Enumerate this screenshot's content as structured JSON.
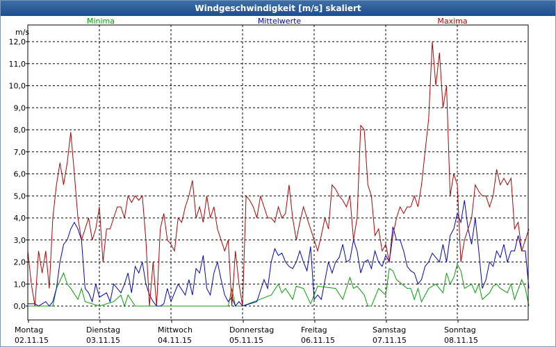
{
  "window": {
    "title": "Windgeschwindigkeit [m/s] skaliert"
  },
  "chart_data": {
    "type": "line",
    "title": "Windgeschwindigkeit [m/s] skaliert",
    "ylabel": "m/s",
    "ylim": [
      0,
      12
    ],
    "xlim": [
      0,
      7
    ],
    "grid": true,
    "yticks": [
      "0,0",
      "1,0",
      "2,0",
      "3,0",
      "4,0",
      "5,0",
      "6,0",
      "7,0",
      "8,0",
      "9,0",
      "10,0",
      "11,0",
      "12,0"
    ],
    "xticks": [
      {
        "day": "Montag",
        "date": "02.11.15"
      },
      {
        "day": "Dienstag",
        "date": "03.11.15"
      },
      {
        "day": "Mittwoch",
        "date": "04.11.15"
      },
      {
        "day": "Donnerstag",
        "date": "05.11.15"
      },
      {
        "day": "Freitag",
        "date": "06.11.15"
      },
      {
        "day": "Samstag",
        "date": "07.11.15"
      },
      {
        "day": "Sonntag",
        "date": "08.11.15"
      }
    ],
    "series": [
      {
        "name": "Minima",
        "color": "#00a000",
        "x": [
          0,
          0.35,
          0.4,
          0.5,
          0.55,
          0.6,
          0.7,
          0.75,
          0.8,
          1.0,
          1.2,
          1.3,
          1.35,
          1.4,
          1.5,
          1.55,
          1.6,
          1.7,
          1.75,
          1.8,
          2.0,
          2.8,
          2.85,
          2.9,
          3.0,
          3.4,
          3.5,
          3.55,
          3.6,
          3.7,
          3.75,
          3.85,
          3.95,
          4.0,
          4.05,
          4.3,
          4.4,
          4.5,
          4.55,
          4.6,
          4.7,
          4.75,
          4.8,
          4.9,
          5.0,
          5.05,
          5.1,
          5.15,
          5.3,
          5.35,
          5.4,
          5.45,
          5.5,
          5.6,
          5.7,
          5.8,
          5.85,
          5.9,
          5.95,
          6.0,
          6.05,
          6.1,
          6.2,
          6.25,
          6.3,
          6.35,
          6.45,
          6.5,
          6.55,
          6.6,
          6.7,
          6.75,
          6.8,
          6.9,
          6.95,
          7.0
        ],
        "y": [
          0,
          0,
          0.8,
          1.5,
          1.0,
          0.8,
          0.3,
          0.8,
          0.2,
          0,
          0.2,
          0.5,
          0,
          0.5,
          0,
          0,
          0,
          0,
          0,
          0,
          0,
          0,
          0.8,
          0,
          0,
          0.5,
          1.0,
          0.6,
          0.8,
          0.3,
          0.9,
          0.8,
          0.1,
          0.5,
          0.9,
          0.8,
          0.3,
          1.3,
          0.8,
          0.9,
          0.5,
          0,
          0,
          0.8,
          0.5,
          1.7,
          1.6,
          1.2,
          0.8,
          0.8,
          0.3,
          0.8,
          0.2,
          0.8,
          1.0,
          0.6,
          1.5,
          1.0,
          1.3,
          1.9,
          1.6,
          0.8,
          1.0,
          0.6,
          1.0,
          0.3,
          0.6,
          0.9,
          1.0,
          0.8,
          0.6,
          1.0,
          0.3,
          1.2,
          0.8,
          0
        ]
      },
      {
        "name": "Mittelwerte",
        "color": "#0000c0",
        "x": [
          0,
          0.1,
          0.15,
          0.2,
          0.25,
          0.3,
          0.35,
          0.4,
          0.45,
          0.5,
          0.55,
          0.6,
          0.65,
          0.7,
          0.75,
          0.8,
          0.85,
          0.9,
          0.95,
          1.0,
          1.1,
          1.15,
          1.2,
          1.3,
          1.35,
          1.4,
          1.45,
          1.5,
          1.55,
          1.6,
          1.65,
          1.7,
          1.75,
          1.8,
          1.85,
          1.9,
          1.95,
          2.0,
          2.1,
          2.2,
          2.25,
          2.3,
          2.35,
          2.4,
          2.45,
          2.5,
          2.55,
          2.6,
          2.65,
          2.7,
          2.75,
          2.8,
          2.85,
          2.9,
          2.95,
          3.0,
          3.2,
          3.3,
          3.35,
          3.4,
          3.45,
          3.5,
          3.55,
          3.6,
          3.65,
          3.7,
          3.75,
          3.8,
          3.85,
          3.9,
          3.95,
          4.0,
          4.05,
          4.1,
          4.2,
          4.25,
          4.3,
          4.35,
          4.4,
          4.45,
          4.5,
          4.55,
          4.6,
          4.65,
          4.7,
          4.75,
          4.8,
          4.85,
          4.9,
          4.95,
          5.0,
          5.05,
          5.1,
          5.15,
          5.2,
          5.25,
          5.3,
          5.35,
          5.4,
          5.45,
          5.5,
          5.55,
          5.6,
          5.65,
          5.7,
          5.75,
          5.8,
          5.85,
          5.9,
          5.95,
          6.0,
          6.05,
          6.1,
          6.15,
          6.2,
          6.25,
          6.3,
          6.35,
          6.4,
          6.45,
          6.5,
          6.55,
          6.6,
          6.65,
          6.7,
          6.75,
          6.8,
          6.85,
          6.9,
          6.95,
          7.0
        ],
        "y": [
          0.1,
          0.1,
          0,
          0.1,
          0.2,
          0,
          0.2,
          0.8,
          2.0,
          2.8,
          3.0,
          3.5,
          3.8,
          3.5,
          3.0,
          0.8,
          0.6,
          0.2,
          1.0,
          0.4,
          0.6,
          0.2,
          1.0,
          0.6,
          1.0,
          1.5,
          0.6,
          1.8,
          1.5,
          2.0,
          1.0,
          0.5,
          0.2,
          0,
          0,
          0.1,
          0.8,
          0.2,
          1.0,
          0.5,
          1.2,
          0.5,
          1.7,
          1.5,
          2.3,
          0.8,
          0.5,
          1.5,
          2.0,
          1.2,
          0.5,
          0.2,
          0.4,
          0,
          0.2,
          0,
          0.2,
          1.2,
          0.8,
          2.0,
          2.6,
          2.3,
          2.4,
          2.0,
          1.8,
          1.7,
          2.0,
          2.5,
          2.0,
          1.6,
          2.7,
          0.3,
          0.5,
          0.3,
          2.0,
          1.5,
          2.0,
          2.2,
          2.8,
          2.0,
          2.1,
          3.0,
          2.5,
          1.5,
          2.0,
          2.1,
          1.7,
          2.5,
          2.0,
          1.8,
          2.3,
          2.0,
          3.6,
          3.0,
          3.0,
          2.5,
          1.8,
          1.6,
          1.5,
          1.0,
          1.2,
          1.8,
          2.0,
          2.4,
          2.2,
          2.0,
          2.8,
          2.0,
          3.2,
          3.5,
          4.2,
          3.8,
          4.8,
          3.5,
          2.8,
          4.0,
          2.5,
          0.8,
          1.2,
          2.0,
          1.8,
          2.5,
          2.2,
          2.8,
          2.0,
          2.5,
          2.5,
          3.2,
          2.5,
          2.5,
          0.8
        ]
      },
      {
        "name": "Maxima",
        "color": "#b00000",
        "x": [
          0,
          0.05,
          0.1,
          0.15,
          0.2,
          0.25,
          0.3,
          0.35,
          0.4,
          0.45,
          0.5,
          0.55,
          0.6,
          0.65,
          0.7,
          0.75,
          0.8,
          0.85,
          0.9,
          0.95,
          1.0,
          1.05,
          1.1,
          1.15,
          1.2,
          1.25,
          1.3,
          1.35,
          1.4,
          1.45,
          1.5,
          1.55,
          1.6,
          1.65,
          1.7,
          1.75,
          1.8,
          1.85,
          1.9,
          1.95,
          2.0,
          2.05,
          2.1,
          2.15,
          2.2,
          2.25,
          2.3,
          2.35,
          2.4,
          2.45,
          2.5,
          2.55,
          2.6,
          2.65,
          2.7,
          2.75,
          2.8,
          2.85,
          2.9,
          2.95,
          3.0,
          3.05,
          3.1,
          3.15,
          3.2,
          3.25,
          3.3,
          3.35,
          3.4,
          3.45,
          3.5,
          3.55,
          3.6,
          3.65,
          3.7,
          3.75,
          3.8,
          3.85,
          3.9,
          3.95,
          4.0,
          4.05,
          4.1,
          4.15,
          4.2,
          4.25,
          4.3,
          4.35,
          4.4,
          4.45,
          4.5,
          4.55,
          4.6,
          4.65,
          4.7,
          4.75,
          4.8,
          4.85,
          4.9,
          4.95,
          5.0,
          5.05,
          5.1,
          5.15,
          5.2,
          5.25,
          5.3,
          5.35,
          5.4,
          5.45,
          5.5,
          5.55,
          5.6,
          5.65,
          5.7,
          5.75,
          5.8,
          5.85,
          5.9,
          5.95,
          6.0,
          6.05,
          6.1,
          6.15,
          6.2,
          6.25,
          6.3,
          6.35,
          6.4,
          6.45,
          6.5,
          6.55,
          6.6,
          6.65,
          6.7,
          6.75,
          6.8,
          6.85,
          6.9,
          6.95,
          7.0
        ],
        "y": [
          2.5,
          1.0,
          0,
          2.5,
          1.5,
          2.5,
          0.8,
          4.0,
          5.5,
          6.5,
          5.5,
          6.5,
          7.9,
          6.0,
          4.0,
          3.0,
          3.5,
          4.0,
          3.0,
          3.5,
          4.5,
          2.0,
          3.5,
          3.5,
          4.0,
          4.5,
          4.5,
          4.0,
          5.0,
          4.7,
          5.0,
          4.8,
          5.0,
          3.0,
          0,
          2.0,
          0,
          3.5,
          4.2,
          3.0,
          2.8,
          2.5,
          4.0,
          3.8,
          4.5,
          5.0,
          5.7,
          4.0,
          4.5,
          3.8,
          5.0,
          4.0,
          4.5,
          3.5,
          3.0,
          2.5,
          3.0,
          0,
          2.5,
          1.0,
          0,
          5.0,
          4.8,
          4.5,
          4.0,
          5.0,
          4.5,
          4.0,
          4.0,
          3.8,
          4.5,
          4.0,
          4.2,
          5.5,
          4.0,
          3.0,
          3.8,
          4.5,
          4.0,
          3.5,
          3.0,
          2.5,
          3.2,
          4.0,
          3.5,
          5.5,
          5.3,
          5.0,
          4.8,
          4.5,
          5.0,
          3.0,
          4.0,
          8.2,
          8.0,
          5.5,
          5.0,
          3.2,
          3.5,
          2.5,
          2.8,
          2.0,
          3.2,
          4.0,
          4.5,
          4.2,
          4.5,
          4.5,
          5.0,
          4.5,
          5.5,
          7.0,
          8.5,
          12.0,
          10.0,
          11.5,
          9.0,
          10.0,
          5.0,
          6.0,
          5.5,
          2.0,
          3.0,
          3.5,
          4.0,
          5.5,
          5.2,
          5.0,
          5.0,
          4.5,
          5.0,
          6.2,
          5.5,
          5.8,
          5.5,
          5.8,
          3.5,
          3.8,
          2.5,
          3.0,
          3.5
        ]
      }
    ]
  }
}
